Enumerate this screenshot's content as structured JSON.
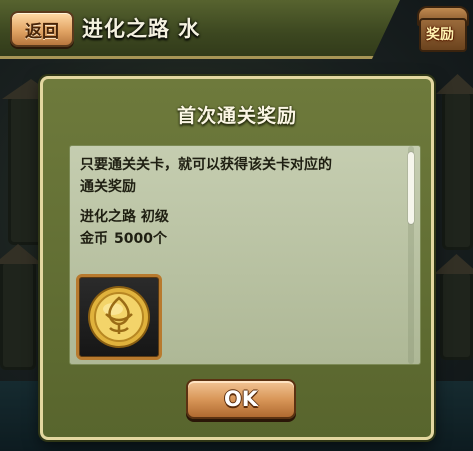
{
  "header": {
    "back_label": "返回",
    "title": "进化之路 水",
    "reward_label": "奖励"
  },
  "dialog": {
    "title": "首次通关奖励",
    "description": "只要通关关卡，就可以获得该关卡对应的\n通关奖励",
    "stage": "进化之路 初级",
    "reward_name": "金币",
    "reward_amount": "5000个",
    "item_icon": "gold-coin-icon",
    "ok_label": "OK"
  },
  "colors": {
    "dialog_bg": "#6e7a3c",
    "dialog_border": "#e3d7a0",
    "panel_bg": "#c5cdb0",
    "button_orange": "#d99759",
    "coin_gold": "#e0b23c"
  }
}
